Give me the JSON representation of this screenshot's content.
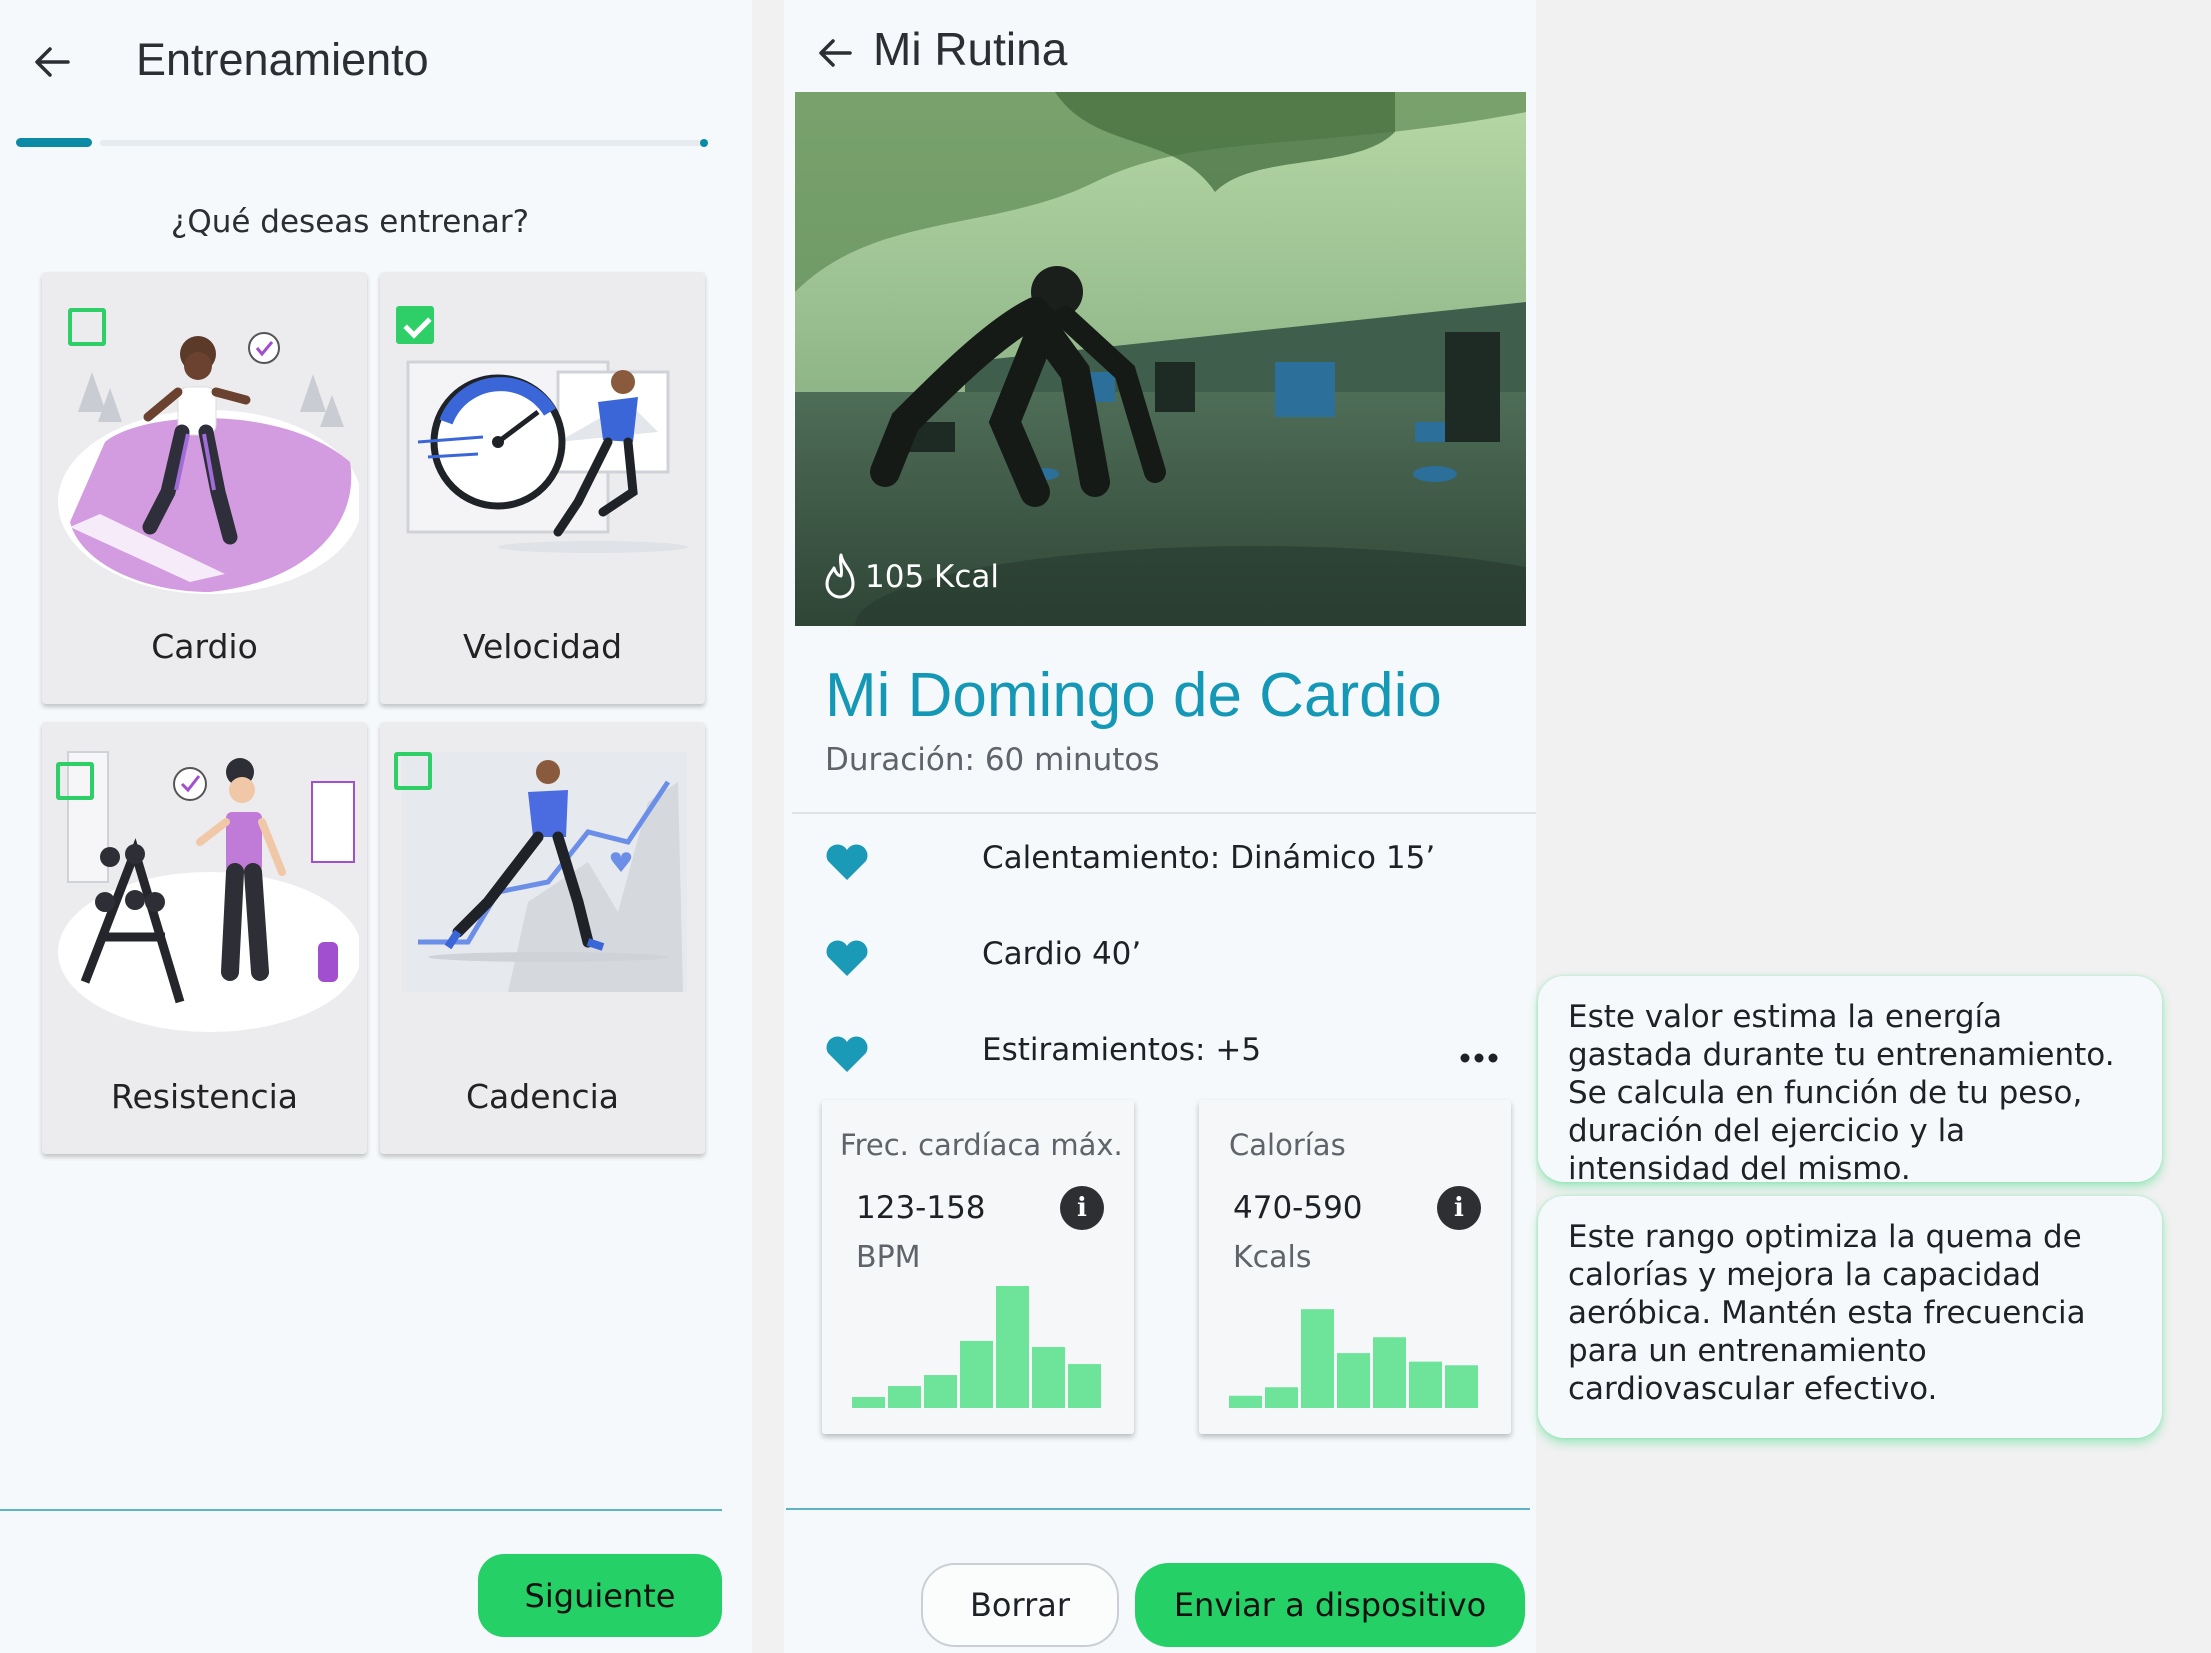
{
  "left_screen": {
    "header": {
      "title": "Entrenamiento"
    },
    "progress": 0.11,
    "question": "¿Qué deseas entrenar?",
    "options": [
      {
        "label": "Cardio",
        "checked": false
      },
      {
        "label": "Velocidad",
        "checked": true
      },
      {
        "label": "Resistencia",
        "checked": false
      },
      {
        "label": "Cadencia",
        "checked": false
      }
    ],
    "next_label": "Siguiente"
  },
  "right_screen": {
    "header": {
      "title": "Mi Rutina"
    },
    "photo_kcal": "105 Kcal",
    "routine": {
      "name": "Mi Domingo de Cardio",
      "duration": "Duración: 60 minutos"
    },
    "items": [
      "Calentamiento: Dinámico 15’",
      "Cardio 40’",
      "Estiramientos: +5"
    ],
    "stats": [
      {
        "label": "Frec. cardíaca máx.",
        "value": "123-158",
        "unit": "BPM",
        "bars": [
          0.09,
          0.18,
          0.27,
          0.55,
          1.0,
          0.5,
          0.36
        ]
      },
      {
        "label": "Calorías",
        "value": "470-590",
        "unit": "Kcals",
        "bars": [
          0.1,
          0.17,
          0.81,
          0.45,
          0.58,
          0.38,
          0.35
        ]
      }
    ],
    "delete_label": "Borrar",
    "send_label": "Enviar a dispositivo"
  },
  "tooltips": [
    "Este valor estima la energía gastada durante tu entrenamiento. Se calcula en función de tu peso, duración del ejercicio y la intensidad del mismo.",
    "Este rango optimiza la quema de calorías y mejora la capacidad aeróbica. Mantén esta frecuencia para un entrenamiento cardiovascular efectivo."
  ],
  "colors": {
    "accent_green": "#25d067",
    "checkbox_green": "#2fcf68",
    "teal": "#0b8aa5",
    "title_blue": "#1598b6",
    "heart": "#1b9ab8",
    "bar_green": "#6ee39a"
  },
  "icons": [
    "back-arrow-icon",
    "check-icon",
    "flame-icon",
    "heart-icon",
    "more-horizontal-icon",
    "info-icon"
  ]
}
